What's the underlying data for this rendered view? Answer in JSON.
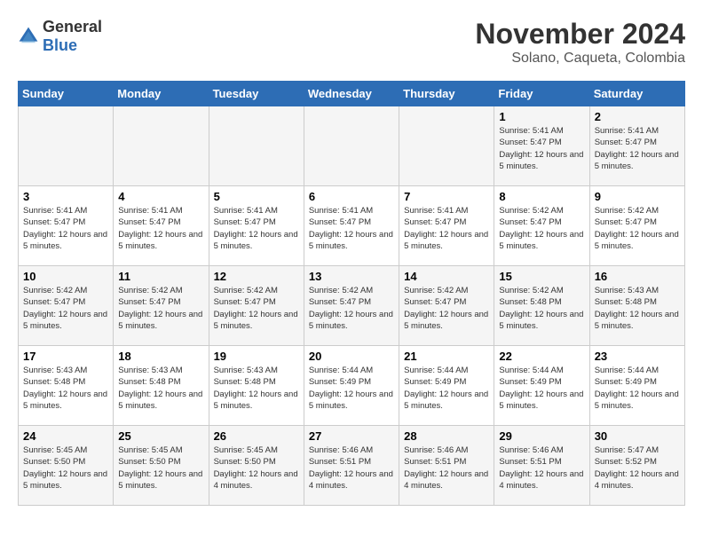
{
  "logo": {
    "general": "General",
    "blue": "Blue"
  },
  "title": "November 2024",
  "location": "Solano, Caqueta, Colombia",
  "days_of_week": [
    "Sunday",
    "Monday",
    "Tuesday",
    "Wednesday",
    "Thursday",
    "Friday",
    "Saturday"
  ],
  "weeks": [
    [
      {
        "day": "",
        "info": ""
      },
      {
        "day": "",
        "info": ""
      },
      {
        "day": "",
        "info": ""
      },
      {
        "day": "",
        "info": ""
      },
      {
        "day": "",
        "info": ""
      },
      {
        "day": "1",
        "info": "Sunrise: 5:41 AM\nSunset: 5:47 PM\nDaylight: 12 hours and 5 minutes."
      },
      {
        "day": "2",
        "info": "Sunrise: 5:41 AM\nSunset: 5:47 PM\nDaylight: 12 hours and 5 minutes."
      }
    ],
    [
      {
        "day": "3",
        "info": "Sunrise: 5:41 AM\nSunset: 5:47 PM\nDaylight: 12 hours and 5 minutes."
      },
      {
        "day": "4",
        "info": "Sunrise: 5:41 AM\nSunset: 5:47 PM\nDaylight: 12 hours and 5 minutes."
      },
      {
        "day": "5",
        "info": "Sunrise: 5:41 AM\nSunset: 5:47 PM\nDaylight: 12 hours and 5 minutes."
      },
      {
        "day": "6",
        "info": "Sunrise: 5:41 AM\nSunset: 5:47 PM\nDaylight: 12 hours and 5 minutes."
      },
      {
        "day": "7",
        "info": "Sunrise: 5:41 AM\nSunset: 5:47 PM\nDaylight: 12 hours and 5 minutes."
      },
      {
        "day": "8",
        "info": "Sunrise: 5:42 AM\nSunset: 5:47 PM\nDaylight: 12 hours and 5 minutes."
      },
      {
        "day": "9",
        "info": "Sunrise: 5:42 AM\nSunset: 5:47 PM\nDaylight: 12 hours and 5 minutes."
      }
    ],
    [
      {
        "day": "10",
        "info": "Sunrise: 5:42 AM\nSunset: 5:47 PM\nDaylight: 12 hours and 5 minutes."
      },
      {
        "day": "11",
        "info": "Sunrise: 5:42 AM\nSunset: 5:47 PM\nDaylight: 12 hours and 5 minutes."
      },
      {
        "day": "12",
        "info": "Sunrise: 5:42 AM\nSunset: 5:47 PM\nDaylight: 12 hours and 5 minutes."
      },
      {
        "day": "13",
        "info": "Sunrise: 5:42 AM\nSunset: 5:47 PM\nDaylight: 12 hours and 5 minutes."
      },
      {
        "day": "14",
        "info": "Sunrise: 5:42 AM\nSunset: 5:47 PM\nDaylight: 12 hours and 5 minutes."
      },
      {
        "day": "15",
        "info": "Sunrise: 5:42 AM\nSunset: 5:48 PM\nDaylight: 12 hours and 5 minutes."
      },
      {
        "day": "16",
        "info": "Sunrise: 5:43 AM\nSunset: 5:48 PM\nDaylight: 12 hours and 5 minutes."
      }
    ],
    [
      {
        "day": "17",
        "info": "Sunrise: 5:43 AM\nSunset: 5:48 PM\nDaylight: 12 hours and 5 minutes."
      },
      {
        "day": "18",
        "info": "Sunrise: 5:43 AM\nSunset: 5:48 PM\nDaylight: 12 hours and 5 minutes."
      },
      {
        "day": "19",
        "info": "Sunrise: 5:43 AM\nSunset: 5:48 PM\nDaylight: 12 hours and 5 minutes."
      },
      {
        "day": "20",
        "info": "Sunrise: 5:44 AM\nSunset: 5:49 PM\nDaylight: 12 hours and 5 minutes."
      },
      {
        "day": "21",
        "info": "Sunrise: 5:44 AM\nSunset: 5:49 PM\nDaylight: 12 hours and 5 minutes."
      },
      {
        "day": "22",
        "info": "Sunrise: 5:44 AM\nSunset: 5:49 PM\nDaylight: 12 hours and 5 minutes."
      },
      {
        "day": "23",
        "info": "Sunrise: 5:44 AM\nSunset: 5:49 PM\nDaylight: 12 hours and 5 minutes."
      }
    ],
    [
      {
        "day": "24",
        "info": "Sunrise: 5:45 AM\nSunset: 5:50 PM\nDaylight: 12 hours and 5 minutes."
      },
      {
        "day": "25",
        "info": "Sunrise: 5:45 AM\nSunset: 5:50 PM\nDaylight: 12 hours and 5 minutes."
      },
      {
        "day": "26",
        "info": "Sunrise: 5:45 AM\nSunset: 5:50 PM\nDaylight: 12 hours and 4 minutes."
      },
      {
        "day": "27",
        "info": "Sunrise: 5:46 AM\nSunset: 5:51 PM\nDaylight: 12 hours and 4 minutes."
      },
      {
        "day": "28",
        "info": "Sunrise: 5:46 AM\nSunset: 5:51 PM\nDaylight: 12 hours and 4 minutes."
      },
      {
        "day": "29",
        "info": "Sunrise: 5:46 AM\nSunset: 5:51 PM\nDaylight: 12 hours and 4 minutes."
      },
      {
        "day": "30",
        "info": "Sunrise: 5:47 AM\nSunset: 5:52 PM\nDaylight: 12 hours and 4 minutes."
      }
    ]
  ]
}
